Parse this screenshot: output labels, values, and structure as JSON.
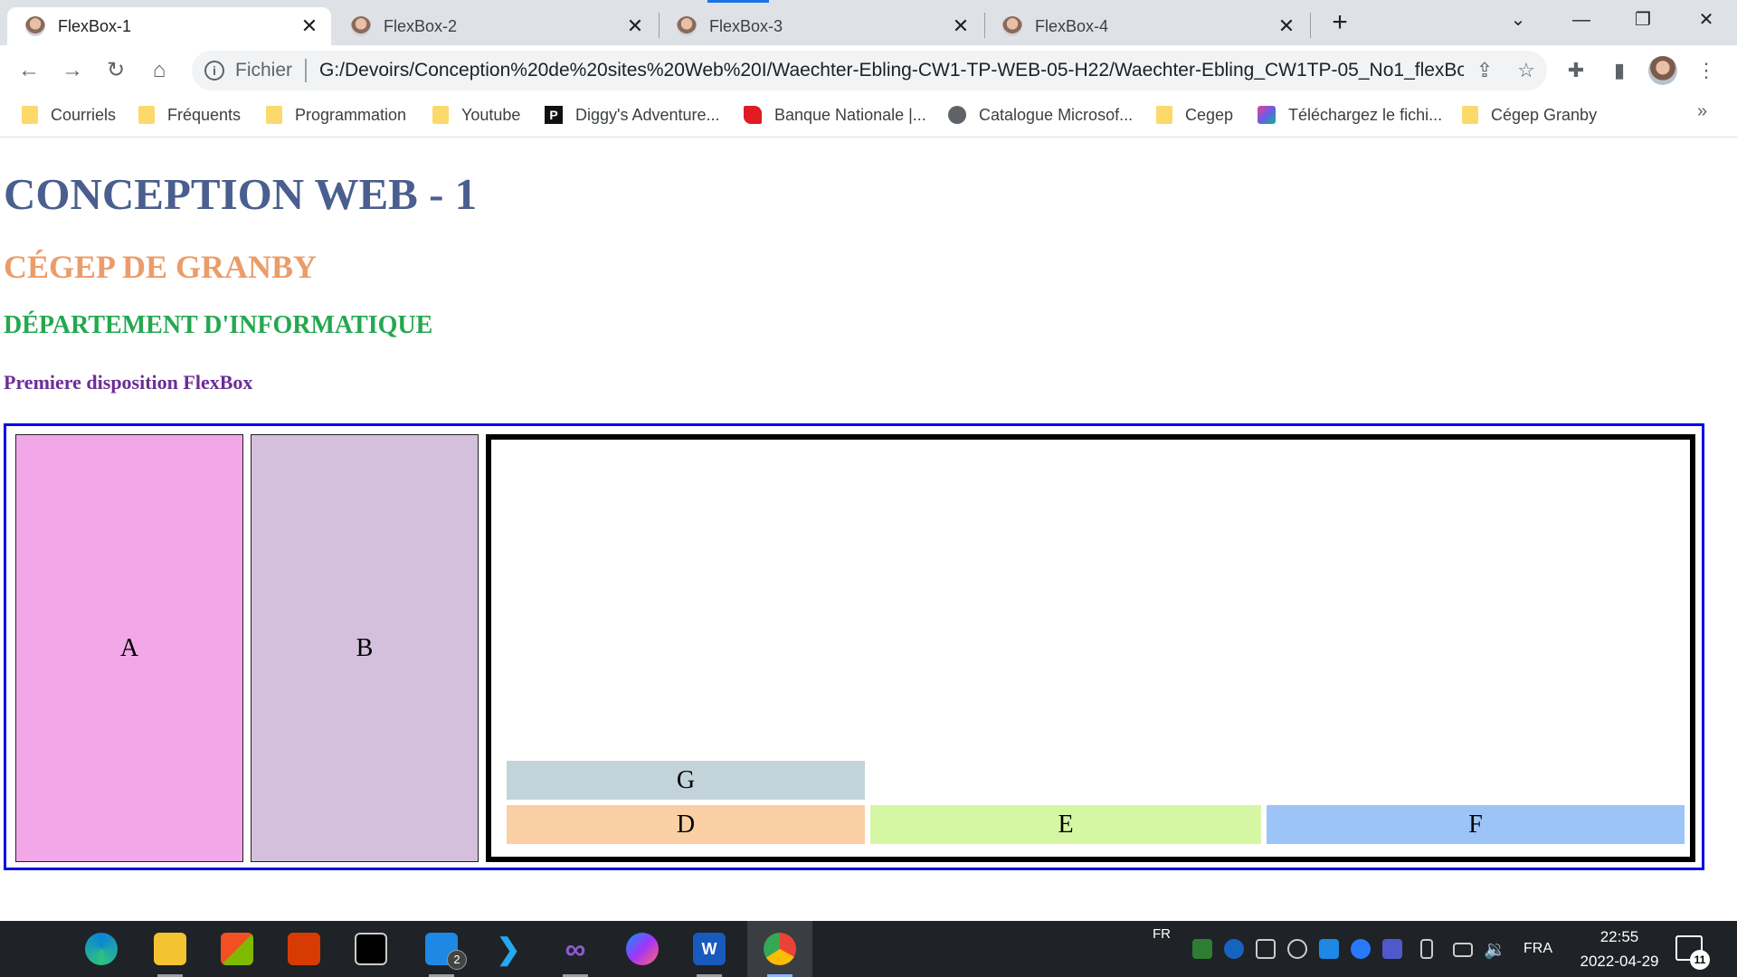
{
  "browser": {
    "tabs": [
      {
        "title": "FlexBox-1",
        "active": true
      },
      {
        "title": "FlexBox-2",
        "active": false
      },
      {
        "title": "FlexBox-3",
        "active": false
      },
      {
        "title": "FlexBox-4",
        "active": false
      }
    ],
    "address": {
      "scheme_label": "Fichier",
      "url": "G:/Devoirs/Conception%20de%20sites%20Web%20I/Waechter-Ebling-CW1-TP-WEB-05-H22/Waechter-Ebling_CW1TP-05_No1_flexBo..."
    },
    "bookmarks": [
      {
        "label": "Courriels",
        "icon": "folder-icon"
      },
      {
        "label": "Fréquents",
        "icon": "folder-icon"
      },
      {
        "label": "Programmation",
        "icon": "folder-icon"
      },
      {
        "label": "Youtube",
        "icon": "folder-icon"
      },
      {
        "label": "Diggy's Adventure...",
        "icon": "diggy-icon"
      },
      {
        "label": "Banque Nationale |...",
        "icon": "bank-flag-icon"
      },
      {
        "label": "Catalogue Microsof...",
        "icon": "globe-icon"
      },
      {
        "label": "Cegep",
        "icon": "folder-icon"
      },
      {
        "label": "Téléchargez le fichi...",
        "icon": "download-site-icon"
      },
      {
        "label": "Cégep Granby",
        "icon": "folder-icon"
      }
    ],
    "bookmarks_more": "»"
  },
  "page": {
    "h1": "CONCEPTION WEB - 1",
    "h2": "CÉGEP DE GRANBY",
    "h3": "DÉPARTEMENT D'INFORMATIQUE",
    "h4": "Premiere disposition FlexBox",
    "boxes": {
      "a": "A",
      "b": "B",
      "g": "G",
      "d": "D",
      "e": "E",
      "f": "F"
    },
    "colors": {
      "h1": "#4a5f8f",
      "h2": "#eb9c6a",
      "h3": "#24a84f",
      "h4": "#6a2d97",
      "container_border": "#0000ee",
      "box_a": "#f2a8e8",
      "box_b": "#d4c0dc",
      "box_g": "#c2d4da",
      "box_d": "#f9cfa3",
      "box_e": "#d5f7a4",
      "box_f": "#9dc4f6"
    }
  },
  "taskbar": {
    "apps": [
      "windows-start-icon",
      "edge-icon",
      "file-explorer-icon",
      "microsoft-store-icon",
      "office-icon",
      "terminal-icon",
      "task-view-icon",
      "vscode-icon",
      "visual-studio-icon",
      "messenger-icon",
      "word-icon",
      "chrome-icon"
    ],
    "task_view_badge": "2",
    "input_lang_short": "FR",
    "language": "FRA",
    "time": "22:55",
    "date": "2022-04-29",
    "notifications": "11"
  }
}
